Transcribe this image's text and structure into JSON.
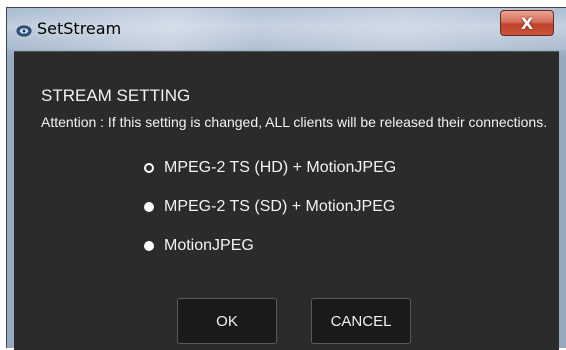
{
  "window": {
    "title": "SetStream",
    "close_label": "X"
  },
  "dialog": {
    "heading": "STREAM SETTING",
    "attention": "Attention : If this setting is changed, ALL clients will be released their connections.",
    "options": [
      {
        "label": "MPEG-2 TS (HD) + MotionJPEG",
        "selected": true
      },
      {
        "label": "MPEG-2 TS (SD) + MotionJPEG",
        "selected": false
      },
      {
        "label": "MotionJPEG",
        "selected": false
      }
    ],
    "ok_label": "OK",
    "cancel_label": "CANCEL"
  },
  "colors": {
    "panel_bg": "#2b2b2b",
    "text": "#f2f2f2",
    "close_red": "#c9543a",
    "button_bg": "#1a1a1a"
  }
}
